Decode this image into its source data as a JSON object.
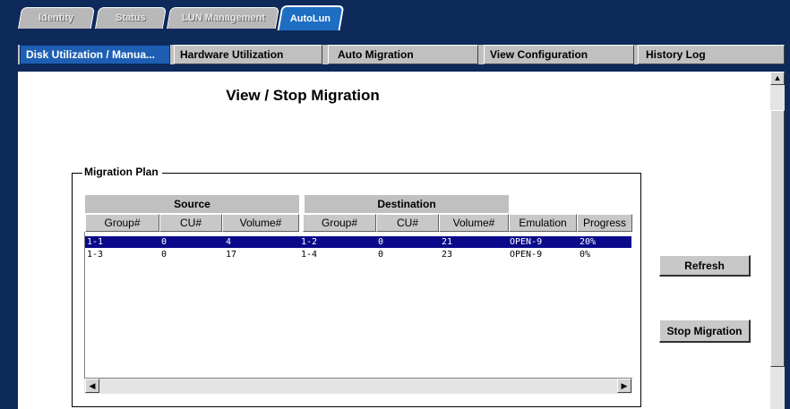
{
  "top_tabs": [
    {
      "label": "Identity"
    },
    {
      "label": "Status"
    },
    {
      "label": "LUN Management"
    },
    {
      "label": "AutoLun"
    }
  ],
  "sub_tabs": [
    {
      "label": "Disk Utilization / Manua..."
    },
    {
      "label": "Hardware Utilization"
    },
    {
      "label": "Auto Migration"
    },
    {
      "label": "View Configuration"
    },
    {
      "label": "History Log"
    }
  ],
  "page": {
    "title": "View / Stop Migration"
  },
  "migration_plan": {
    "label": "Migration Plan",
    "group_headers": {
      "source": "Source",
      "destination": "Destination"
    },
    "columns": [
      "Group#",
      "CU#",
      "Volume#",
      "Group#",
      "CU#",
      "Volume#",
      "Emulation",
      "Progress"
    ],
    "rows": [
      {
        "src_group": "1-1",
        "src_cu": "0",
        "src_volume": "4",
        "dst_group": "1-2",
        "dst_cu": "0",
        "dst_volume": "21",
        "emulation": "OPEN-9",
        "progress": "20%"
      },
      {
        "src_group": "1-3",
        "src_cu": "0",
        "src_volume": "17",
        "dst_group": "1-4",
        "dst_cu": "0",
        "dst_volume": "23",
        "emulation": "OPEN-9",
        "progress": "0%"
      }
    ]
  },
  "buttons": {
    "refresh": "Refresh",
    "stop_migration": "Stop Migration"
  },
  "icons": {
    "scroll_up": "arrow-up-icon",
    "scroll_left": "arrow-left-icon",
    "scroll_right": "arrow-right-icon"
  },
  "colors": {
    "frame_bg": "#0d2a5a",
    "active_tab": "#1e6ec4",
    "selected_row": "#0a0a8a"
  }
}
